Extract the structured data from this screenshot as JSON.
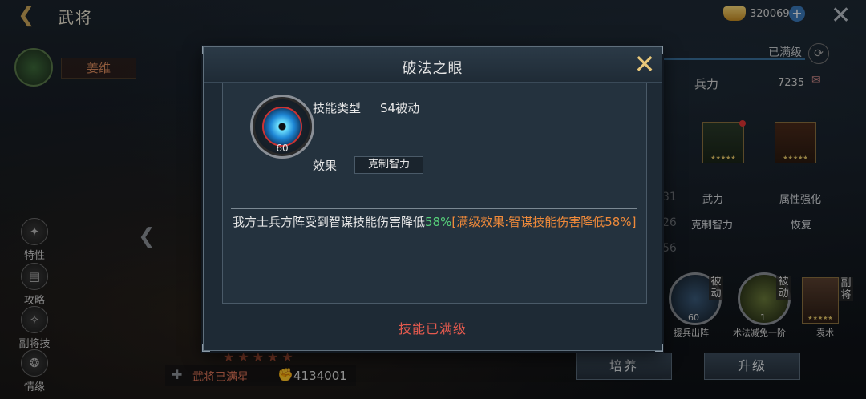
{
  "header": {
    "title": "武将",
    "currency": "320069"
  },
  "hero": {
    "name": "姜维",
    "maxed_label": "武将已满星",
    "power": "4134001"
  },
  "side_menu": [
    {
      "label": "特性"
    },
    {
      "label": "攻略"
    },
    {
      "label": "副将技"
    },
    {
      "label": "情缘"
    }
  ],
  "right_panel": {
    "maxed": "已满级",
    "troops_label": "兵力",
    "troops_value": "7235",
    "stat_row1": [
      "武力",
      "属性强化"
    ],
    "stat_row2": [
      "克制智力",
      "恢复"
    ],
    "partial_numbers": [
      "31",
      "26",
      "56"
    ],
    "skills": [
      {
        "tag": "被动",
        "level": "60",
        "name": "援兵出阵"
      },
      {
        "tag": "被动",
        "level": "1",
        "name": "术法减免一阶"
      },
      {
        "tag": "副将",
        "name": "袁术"
      }
    ],
    "buttons": {
      "train": "培养",
      "upgrade": "升级"
    }
  },
  "modal": {
    "title": "破法之眼",
    "skill_level": "60",
    "type_label": "技能类型",
    "type_value": "S4被动",
    "effect_label": "效果",
    "effect_value": "克制智力",
    "description": {
      "main": "我方士兵方阵受到智谋技能伤害降低",
      "value": "58%",
      "maxed_effect": "[满级效果:智谋技能伤害降低58%]"
    },
    "footer": "技能已满级"
  },
  "colors": {
    "accent_gold": "#e8c77a",
    "maxed_red": "#e55a4e",
    "value_green": "#57d07a",
    "max_effect_orange": "#f08a3a"
  }
}
